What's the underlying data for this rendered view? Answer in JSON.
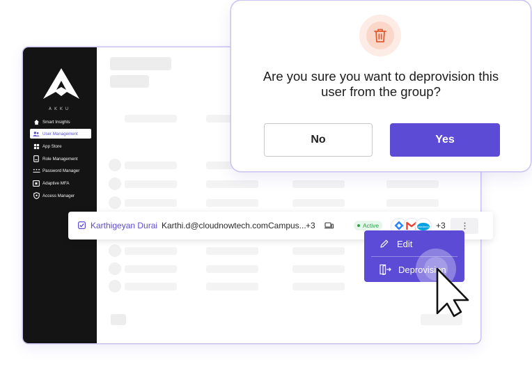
{
  "sidebar": {
    "brand": "AKKU",
    "items": [
      {
        "label": "Smart Insights",
        "icon": "home-icon"
      },
      {
        "label": "User Management",
        "icon": "users-icon",
        "active": true
      },
      {
        "label": "App Store",
        "icon": "store-icon"
      },
      {
        "label": "Role Management",
        "icon": "role-icon"
      },
      {
        "label": "Password Manager",
        "icon": "password-icon"
      },
      {
        "label": "Adaptive MFA",
        "icon": "mfa-icon"
      },
      {
        "label": "Access Manager",
        "icon": "shield-icon"
      }
    ]
  },
  "user_row": {
    "name": "Karthigeyan Durai",
    "email": "Karthi.d@cloudnowtech.com",
    "group": "Campus...",
    "group_more": "+3",
    "status": "Active",
    "apps_more": "+3",
    "apps": [
      "jira-icon",
      "gmail-icon",
      "salesforce-icon"
    ],
    "checked": true
  },
  "context_menu": {
    "edit_label": "Edit",
    "deprovision_label": "Deprovision"
  },
  "dialog": {
    "title_line1": "Are you sure you want to deprovision this",
    "title_line2": "user from the group?",
    "no_label": "No",
    "yes_label": "Yes",
    "icon": "trash-icon"
  },
  "colors": {
    "accent": "#5b4bd5",
    "sidebar_bg": "#141414",
    "danger": "#e25a2f",
    "danger_bg": "#fde6dd",
    "active_status": "#2ea44f"
  }
}
